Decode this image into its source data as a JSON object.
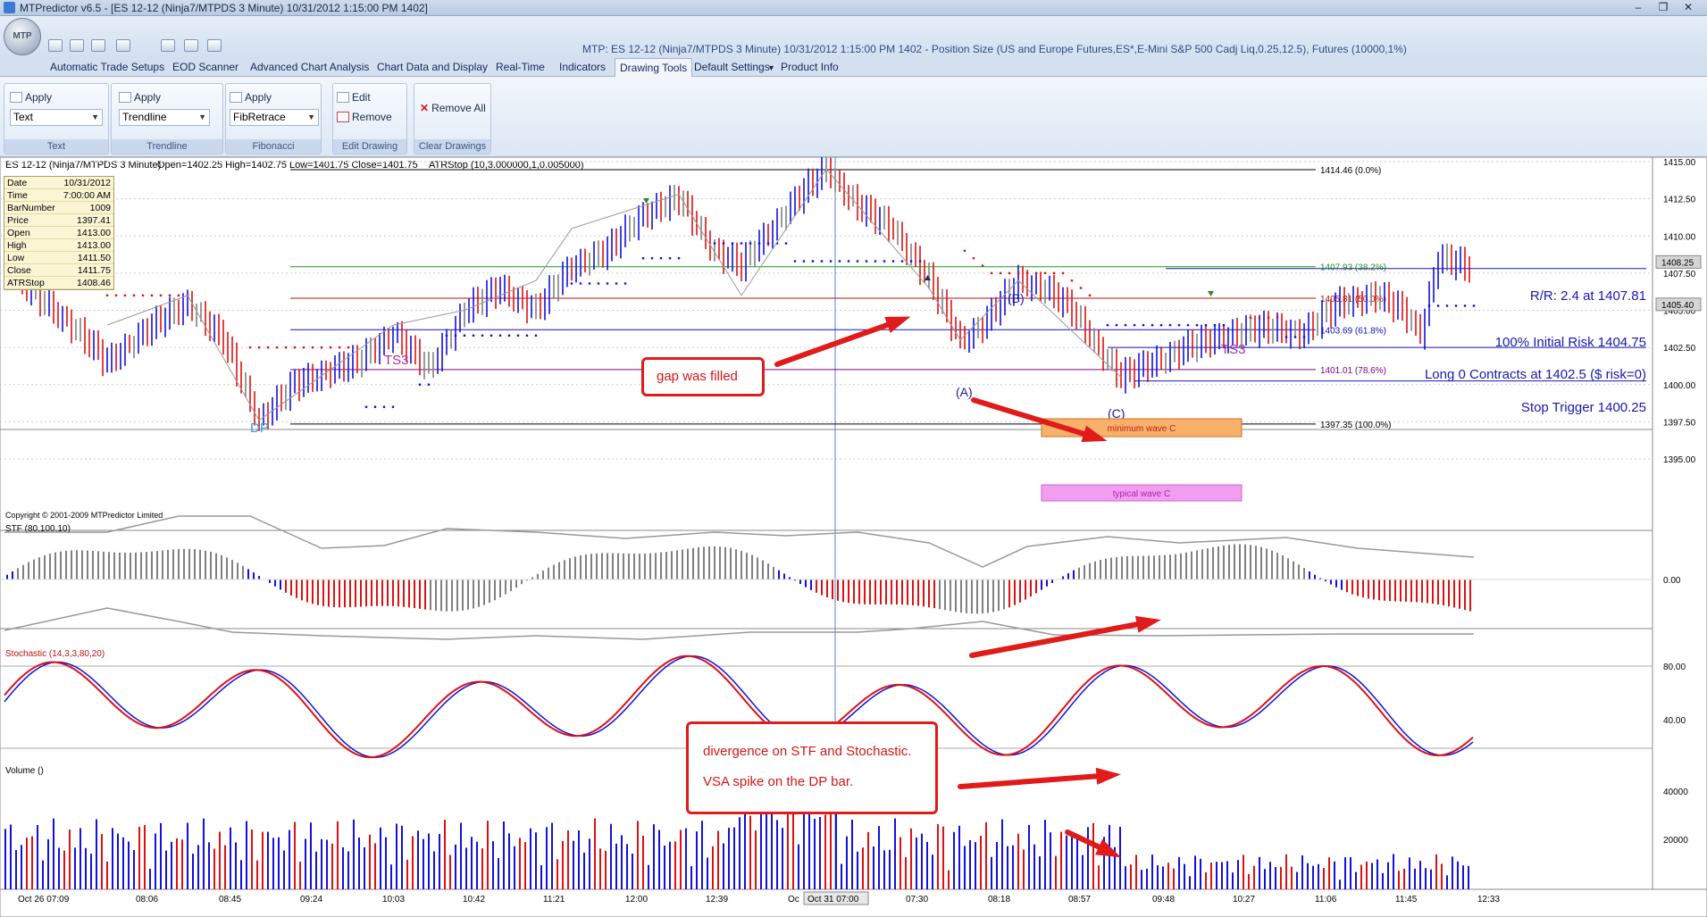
{
  "window": {
    "title": "MTPredictor v6.5 - [ES 12-12 (Ninja7/MTPDS 3 Minute) 10/31/2012 1:15:00 PM 1402]",
    "orb_label": "MTP",
    "info": "MTP: ES 12-12 (Ninja7/MTPDS 3 Minute) 10/31/2012 1:15:00 PM 1402 - Position Size (US and Europe Futures,ES*,E-Mini S&P 500 Cadj Liq,0.25,12.5), Futures (10000,1%)"
  },
  "tabs": [
    "Automatic Trade Setups",
    "EOD Scanner",
    "Advanced Chart Analysis",
    "Chart Data and Display",
    "Real-Time",
    "Indicators",
    "Drawing Tools",
    "Default Settings",
    "Product Info"
  ],
  "active_tab": "Drawing Tools",
  "ribbon": {
    "text_group": {
      "apply": "Apply",
      "combo": "Text",
      "label": "Text"
    },
    "trendline_group": {
      "apply": "Apply",
      "combo": "Trendline",
      "label": "Trendline"
    },
    "fib_group": {
      "apply": "Apply",
      "combo": "FibRetrace",
      "label": "Fibonacci"
    },
    "edit_group": {
      "edit": "Edit",
      "remove": "Remove",
      "label": "Edit Drawing"
    },
    "clear_group": {
      "remove_all": "Remove All",
      "label": "Clear Drawings"
    }
  },
  "chart_header": {
    "symbol": "ES 12-12 (Ninja7/MTPDS 3 Minute)",
    "ohlc": "Open=1402.25   High=1402.75   Low=1401.75   Close=1401.75",
    "indicator": "ATRStop (10,3.000000,1,0.005000)"
  },
  "databox": [
    [
      "Date",
      "10/31/2012"
    ],
    [
      "Time",
      "7:00:00 AM"
    ],
    [
      "BarNumber",
      "1009"
    ],
    [
      "Price",
      "1397.41"
    ],
    [
      "Open",
      "1413.00"
    ],
    [
      "High",
      "1413.00"
    ],
    [
      "Low",
      "1411.50"
    ],
    [
      "Close",
      "1411.75"
    ],
    [
      "ATRStop",
      "1408.46"
    ]
  ],
  "price_axis": [
    "1415.00",
    "1412.50",
    "1410.00",
    "1407.50",
    "1405.00",
    "1402.50",
    "1400.00",
    "1397.50",
    "1395.00"
  ],
  "price_tags": [
    "1408.25",
    "1405.40"
  ],
  "fib_levels": [
    "1414.46 (0.0%)",
    "1407.93 (38.2%)",
    "1405.81 (50.0%)",
    "1403.69 (61.8%)",
    "1401.01 (78.6%)",
    "1397.35 (100.0%)"
  ],
  "chart_labels": {
    "dp": "DP",
    "ts3_left": "TS3",
    "ts3_right": "TS3",
    "a": "(A)",
    "b": "(B)",
    "c": "(C)",
    "min_wave": "minimum wave C",
    "typical_wave": "typical wave C",
    "copyright": "Copyright © 2001-2009 MTPredictor Limited"
  },
  "trade_info": {
    "rr": "R/R: 2.4 at 1407.81",
    "risk": "100% Initial Risk 1404.75",
    "long": "Long 0 Contracts at 1402.5 ($ risk=0)",
    "stop": "Stop Trigger 1400.25"
  },
  "callouts": {
    "gap": "gap was filled",
    "divergence": "divergence on STF and Stochastic.",
    "vsa": "VSA spike on the DP bar."
  },
  "panels": {
    "stf": {
      "label": "STF (80,100,10)",
      "axis": "0.00"
    },
    "stoch": {
      "label": "Stochastic (14,3,3,80,20)",
      "axis": [
        "80.00",
        "40.00"
      ]
    },
    "volume": {
      "label": "Volume ()",
      "axis": [
        "40000",
        "20000"
      ]
    }
  },
  "time_axis": [
    "Oct 26 07:09",
    "08:06",
    "08:45",
    "09:24",
    "10:03",
    "10:42",
    "11:21",
    "12:00",
    "12:39",
    "Oc",
    "07:30",
    "08:18",
    "08:57",
    "09:48",
    "10:27",
    "11:06",
    "11:45",
    "12:33"
  ],
  "cursor_time": "Oct 31 07:00",
  "colors": {
    "up": "#1010e0",
    "down": "#e01010",
    "neutral": "#808080",
    "accent": "#e11a1a"
  }
}
